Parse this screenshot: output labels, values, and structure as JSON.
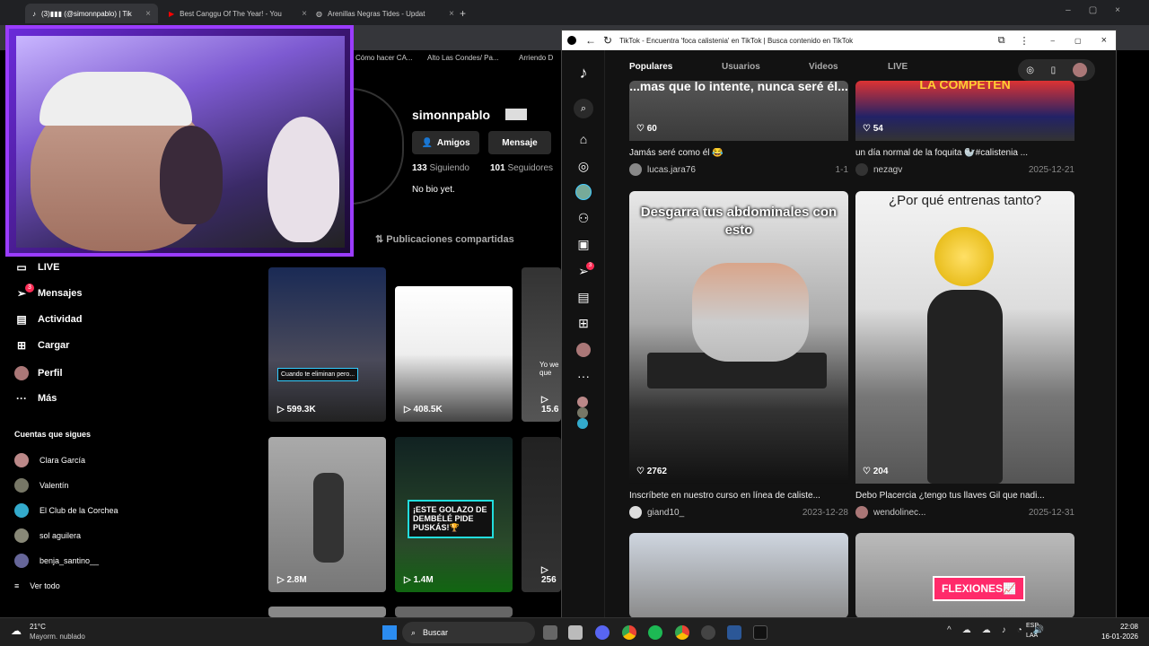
{
  "bg_browser": {
    "tabs": [
      {
        "label": "(3)▮▮▮ (@simonnpablo) | Tik",
        "active": true
      },
      {
        "label": "Best Canggu Of The Year! - You",
        "active": false
      },
      {
        "label": "Arenillas Negras Tides - Updat",
        "active": false
      }
    ],
    "new_tab": "+",
    "bookmarks": [
      "Cómo hacer CA...",
      "Alto Las Condes/ Pa...",
      "Arriendo D"
    ]
  },
  "profile": {
    "username": "simonnpablo",
    "friends_button": "Amigos",
    "message_button": "Mensaje",
    "following_count": "133",
    "following_label": "Siguiendo",
    "followers_count": "101",
    "followers_label": "Seguidores",
    "bio": "No bio yet.",
    "shared_posts": "Publicaciones compartidas"
  },
  "sidebar": {
    "items": [
      {
        "label": "LIVE",
        "icon": "live-icon"
      },
      {
        "label": "Mensajes",
        "icon": "send-icon",
        "badge": "3"
      },
      {
        "label": "Actividad",
        "icon": "activity-icon"
      },
      {
        "label": "Cargar",
        "icon": "upload-icon"
      },
      {
        "label": "Perfil",
        "icon": "avatar-icon"
      },
      {
        "label": "Más",
        "icon": "more-icon"
      }
    ],
    "following_title": "Cuentas que sigues",
    "following": [
      "Clara García",
      "Valentín",
      "El Club de la Corchea",
      "sol aguilera",
      "benja_santino__"
    ],
    "see_all": "Ver todo"
  },
  "bg_videos": [
    {
      "views": "599.3K",
      "caption": "Cuando te eliminan pero..."
    },
    {
      "views": "408.5K",
      "caption": ""
    },
    {
      "views": "15.6",
      "caption": "Yo we que"
    },
    {
      "views": "2.8M",
      "caption": ""
    },
    {
      "views": "1.4M",
      "caption": "¡ESTE GOLAZO DE DEMBÉLÉ PIDE PUSKÁS!🏆"
    },
    {
      "views": "256",
      "caption": ""
    }
  ],
  "popup": {
    "title": "TikTok - Encuentra 'foca calistenia' en TikTok | Busca contenido en TikTok",
    "tabs": [
      "Populares",
      "Usuarios",
      "Videos",
      "LIVE"
    ],
    "active_tab": "Populares",
    "rail_badge": "3",
    "cards": [
      {
        "overlay": "...mas que lo intente, nunca seré él...",
        "likes": "60",
        "caption": "Jamás seré como él 😂",
        "author": "lucas.jara76",
        "date": "1-1"
      },
      {
        "overlay": "LA COMPETEN",
        "likes": "54",
        "caption": "un día normal de la foquita 🦭#calistenia ...",
        "author": "nezagv",
        "date": "2025-12-21"
      },
      {
        "overlay": "Desgarra tus abdominales con esto",
        "likes": "2762",
        "caption": "Inscríbete en nuestro curso en línea de caliste...",
        "author": "giand10_",
        "date": "2023-12-28"
      },
      {
        "overlay": "¿Por qué entrenas tanto?",
        "likes": "204",
        "caption": "Debo Placercia ¿tengo tus llaves Gil que nadi...",
        "author": "wendolinec...",
        "date": "2025-12-31"
      },
      {
        "overlay": "",
        "likes": "",
        "caption": "",
        "author": "",
        "date": ""
      },
      {
        "overlay": "FLEXIONES📈",
        "likes": "",
        "caption": "",
        "author": "",
        "date": ""
      }
    ]
  },
  "taskbar": {
    "weather_temp": "21°C",
    "weather_desc": "Mayorm. nublado",
    "search": "Buscar",
    "lang1": "ESP",
    "lang2": "LAA",
    "time": "22:08",
    "date": "16-01-2026"
  }
}
